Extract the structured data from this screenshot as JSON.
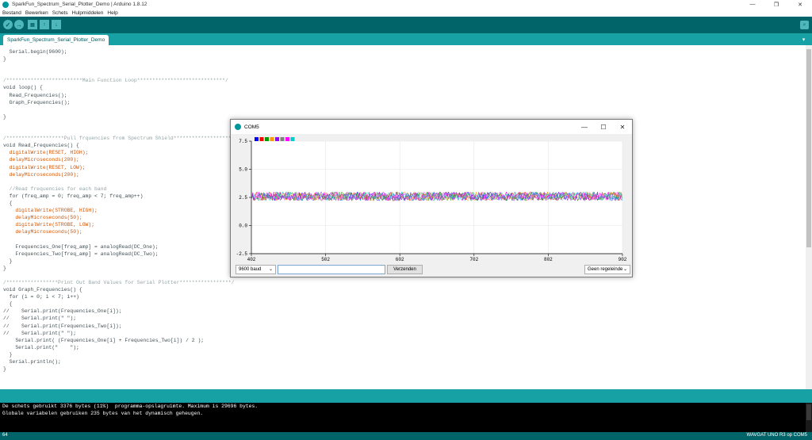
{
  "window": {
    "title": "SparkFun_Spectrum_Serial_Plotter_Demo | Arduino 1.8.12",
    "minimize_label": "—",
    "maximize_label": "❐",
    "close_label": "✕"
  },
  "menubar": {
    "items": [
      "Bestand",
      "Bewerken",
      "Schets",
      "Hulpmiddelen",
      "Help"
    ]
  },
  "toolbar": {
    "icons": [
      "verify-icon",
      "upload-icon",
      "new-icon",
      "open-icon",
      "save-icon",
      "serial-monitor-icon"
    ]
  },
  "tabs": {
    "active": "SparkFun_Spectrum_Serial_Plotter_Demo",
    "menu_icon": "▾"
  },
  "editor": {
    "lines": [
      {
        "text": "  Serial.begin(9600);",
        "style": "code"
      },
      {
        "text": "}",
        "style": "code"
      },
      {
        "text": "",
        "style": "code"
      },
      {
        "text": "",
        "style": "code"
      },
      {
        "text": "/*************************Main Function Loop*****************************/",
        "style": "comment"
      },
      {
        "text": "void loop() {",
        "style": "code"
      },
      {
        "text": "  Read_Frequencies();",
        "style": "code"
      },
      {
        "text": "  Graph_Frequencies();",
        "style": "code"
      },
      {
        "text": "",
        "style": "code"
      },
      {
        "text": "}",
        "style": "code"
      },
      {
        "text": "",
        "style": "code"
      },
      {
        "text": "",
        "style": "code"
      },
      {
        "text": "/*******************Pull frquencies from Spectrum Shield**********************/",
        "style": "comment"
      },
      {
        "text": "void Read_Frequencies() {",
        "style": "code"
      },
      {
        "text": "  digitalWrite(RESET, HIGH);",
        "style": "fn"
      },
      {
        "text": "  delayMicroseconds(200);",
        "style": "fn"
      },
      {
        "text": "  digitalWrite(RESET, LOW);",
        "style": "fn"
      },
      {
        "text": "  delayMicroseconds(200);",
        "style": "fn"
      },
      {
        "text": "",
        "style": "code"
      },
      {
        "text": "  //Read frequencies for each band",
        "style": "comment"
      },
      {
        "text": "  for (freq_amp = 0; freq_amp < 7; freq_amp++)",
        "style": "code"
      },
      {
        "text": "  {",
        "style": "code"
      },
      {
        "text": "    digitalWrite(STROBE, HIGH);",
        "style": "fn"
      },
      {
        "text": "    delayMicroseconds(50);",
        "style": "fn"
      },
      {
        "text": "    digitalWrite(STROBE, LOW);",
        "style": "fn"
      },
      {
        "text": "    delayMicroseconds(50);",
        "style": "fn"
      },
      {
        "text": "",
        "style": "code"
      },
      {
        "text": "    Frequencies_One[freq_amp] = analogRead(DC_One);",
        "style": "code"
      },
      {
        "text": "    Frequencies_Two[freq_amp] = analogRead(DC_Two);",
        "style": "code"
      },
      {
        "text": "  }",
        "style": "code"
      },
      {
        "text": "}",
        "style": "code"
      },
      {
        "text": "",
        "style": "code"
      },
      {
        "text": "/*****************Print Out Band Values for Serial Plotter*****************/",
        "style": "comment"
      },
      {
        "text": "void Graph_Frequencies() {",
        "style": "code"
      },
      {
        "text": "  for (i = 0; i < 7; i++)",
        "style": "code"
      },
      {
        "text": "  {",
        "style": "code"
      },
      {
        "text": "//    Serial.print(Frequencies_One[i]);",
        "style": "code"
      },
      {
        "text": "//    Serial.print(\" \");",
        "style": "code"
      },
      {
        "text": "//    Serial.print(Frequencies_Two[i]);",
        "style": "code"
      },
      {
        "text": "//    Serial.print(\" \");",
        "style": "code"
      },
      {
        "text": "    Serial.print( (Frequencies_One[i] + Frequencies_Two[i]) / 2 );",
        "style": "code"
      },
      {
        "text": "    Serial.print(\"    \");",
        "style": "code"
      },
      {
        "text": "  }",
        "style": "code"
      },
      {
        "text": "  Serial.println();",
        "style": "code"
      },
      {
        "text": "}",
        "style": "code"
      }
    ]
  },
  "console": {
    "lines": [
      "De schets gebruikt 3376 bytes (11%)  programma-opslagruimte. Maximum is 29696 bytes.",
      "Globale variabelen gebruiken 235 bytes van het dynamisch geheugen."
    ]
  },
  "statusbar": {
    "line_number": "64",
    "board": "WAVGAT UNO R3 op COM5"
  },
  "plotter": {
    "title": "COM5",
    "minimize_label": "—",
    "maximize_label": "☐",
    "close_label": "✕",
    "baud": "9600 baud",
    "send_input_value": "",
    "send_label": "Verzenden",
    "line_ending": "Geen regeleinde",
    "chevron": "⌄"
  },
  "chart_data": {
    "type": "line",
    "title": "",
    "xlabel": "",
    "ylabel": "",
    "xlim": [
      402,
      902
    ],
    "ylim": [
      -2.5,
      7.5
    ],
    "x_ticks": [
      "402",
      "502",
      "602",
      "702",
      "802",
      "902"
    ],
    "y_ticks": [
      "7.5",
      "5.0",
      "2.5",
      "0.0",
      "-2.5"
    ],
    "y_tick_values": [
      7.5,
      5.0,
      2.5,
      0.0,
      -2.5
    ],
    "grid": true,
    "legend_position": "top-left",
    "series_colors": [
      "#0000ff",
      "#ff0000",
      "#009900",
      "#ff9900",
      "#9900ff",
      "#808080",
      "#ff00ff",
      "#00cccc"
    ],
    "series_range": [
      2.2,
      3.0
    ]
  }
}
